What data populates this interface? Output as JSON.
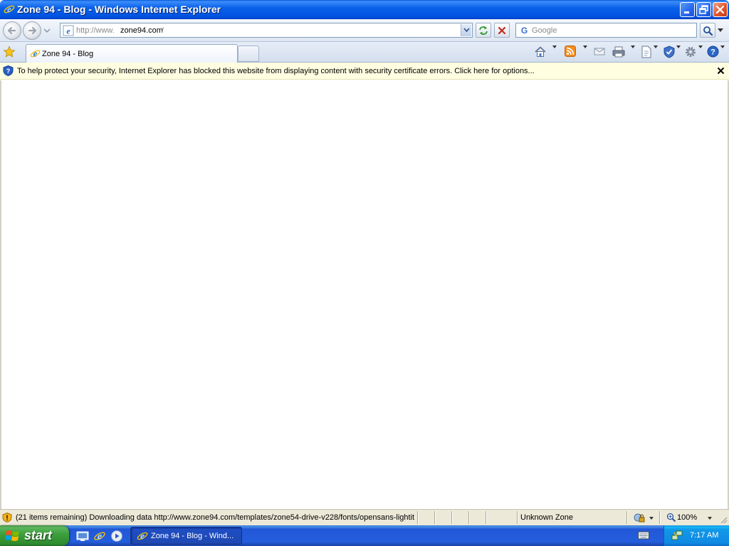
{
  "window": {
    "title": "Zone 94 - Blog - Windows Internet Explorer"
  },
  "address_bar": {
    "url_prefix": "http://www.",
    "url_domain": "zone94.com",
    "url_suffix": "/"
  },
  "search": {
    "placeholder": "Google"
  },
  "tabs": [
    {
      "label": "Zone 94 - Blog",
      "active": true
    }
  ],
  "command_bar": {
    "icons": [
      "home-icon",
      "feeds-icon",
      "read-mail-icon",
      "print-icon",
      "page-icon",
      "safety-icon",
      "tools-icon",
      "help-icon"
    ]
  },
  "info_bar": {
    "message": "To help protect your security, Internet Explorer has blocked this website from displaying content with security certificate errors. Click here for options..."
  },
  "status_bar": {
    "text": "(21 items remaining) Downloading data http://www.zone94.com/templates/zone54-drive-v228/fonts/opensans-lightit",
    "zone": "Unknown Zone",
    "zoom": "100%"
  },
  "taskbar": {
    "start_label": "start",
    "task_label": "Zone 94 - Blog - Wind...",
    "clock": "7:17 AM"
  },
  "colors": {
    "title_bar": "#0054e3",
    "info_bar_bg": "#fffee1",
    "taskbar": "#245edc",
    "start_button": "#3c9a3c",
    "tray": "#0f8ae3"
  }
}
